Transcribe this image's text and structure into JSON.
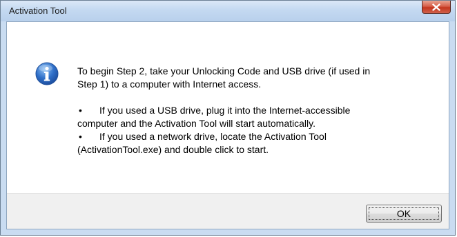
{
  "window": {
    "title": "Activation Tool",
    "close_icon": "close-icon"
  },
  "dialog": {
    "icon": "information-icon",
    "line1": "To begin Step 2, take your Unlocking Code and USB drive (if used in",
    "line2": "Step 1) to a computer with Internet access.",
    "bullet_mark": "•",
    "bullet1_line1": "If you used a USB drive, plug it into the Internet-accessible",
    "bullet1_line2": "computer and the Activation Tool will start automatically.",
    "bullet2_line1": "If you used a network drive, locate the Activation Tool",
    "bullet2_line2": "(ActivationTool.exe) and double click to start."
  },
  "buttons": {
    "ok_label": "OK"
  },
  "colors": {
    "titlebar": "#c4d9f1",
    "close_button": "#c4351c",
    "info_icon": "#2f6fc8",
    "button_strip": "#f0f0f0"
  }
}
